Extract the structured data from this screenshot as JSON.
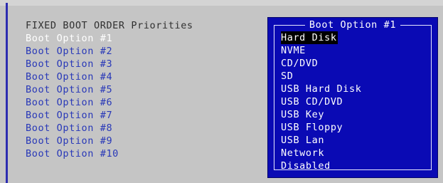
{
  "boot_order": {
    "heading": "FIXED BOOT ORDER Priorities",
    "options": [
      {
        "label": "Boot Option #1"
      },
      {
        "label": "Boot Option #2"
      },
      {
        "label": "Boot Option #3"
      },
      {
        "label": "Boot Option #4"
      },
      {
        "label": "Boot Option #5"
      },
      {
        "label": "Boot Option #6"
      },
      {
        "label": "Boot Option #7"
      },
      {
        "label": "Boot Option #8"
      },
      {
        "label": "Boot Option #9"
      },
      {
        "label": "Boot Option #10"
      }
    ],
    "selected_index": 0
  },
  "popup": {
    "title": "Boot Option #1",
    "items": [
      "Hard Disk",
      "NVME",
      "CD/DVD",
      "SD",
      "USB Hard Disk",
      "USB CD/DVD",
      "USB Key",
      "USB Floppy",
      "USB Lan",
      "Network",
      "Disabled"
    ],
    "selected_index": 0
  },
  "colors": {
    "background": "#c5c5c5",
    "option_text": "#2838b8",
    "popup_background": "#0a0ab4",
    "highlight": "#000000"
  }
}
